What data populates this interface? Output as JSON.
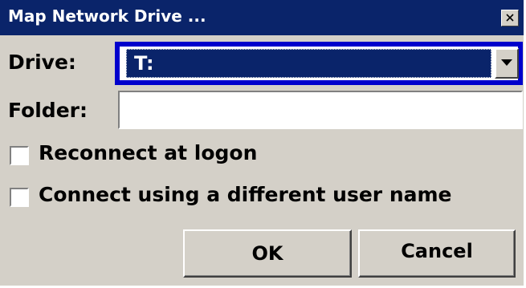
{
  "window": {
    "title": "Map Network Drive ...",
    "close_icon": "close-icon"
  },
  "form": {
    "drive_label": "Drive:",
    "drive_value": "T:",
    "folder_label": "Folder:",
    "folder_value": "",
    "folder_placeholder": ""
  },
  "options": [
    {
      "label": "Reconnect at logon",
      "checked": false
    },
    {
      "label": "Connect using a different user name",
      "checked": false
    }
  ],
  "buttons": {
    "ok_label": "OK",
    "cancel_label": "Cancel"
  },
  "colors": {
    "title_bar": "#0a246a",
    "dialog_bg": "#d4d0c8",
    "focus_border": "#0000cc",
    "selection": "#0a246a"
  }
}
